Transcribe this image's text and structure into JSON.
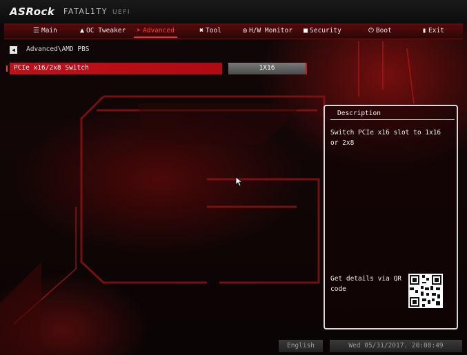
{
  "brand": {
    "logo": "ASRock",
    "series": "FATAL1TY",
    "uefi": "UEFI"
  },
  "nav": {
    "tabs": [
      {
        "label": "Main",
        "icon": "list-icon"
      },
      {
        "label": "OC Tweaker",
        "icon": "rocket-icon"
      },
      {
        "label": "Advanced",
        "icon": "arrow-icon",
        "active": true
      },
      {
        "label": "Tool",
        "icon": "tool-icon"
      },
      {
        "label": "H/W Monitor",
        "icon": "monitor-icon"
      },
      {
        "label": "Security",
        "icon": "shield-icon"
      },
      {
        "label": "Boot",
        "icon": "power-icon"
      },
      {
        "label": "Exit",
        "icon": "exit-icon"
      }
    ]
  },
  "breadcrumb": {
    "path": "Advanced\\AMD PBS"
  },
  "options": [
    {
      "label": "PCIe x16/2x8 Switch",
      "value": "1X16"
    }
  ],
  "description": {
    "title": "Description",
    "text": "Switch PCIe x16 slot to 1x16 or 2x8",
    "qr_text": "Get details via QR code"
  },
  "footer": {
    "language": "English",
    "datetime": "Wed 05/31/2017. 20:08:49"
  },
  "colors": {
    "accent": "#c0101a",
    "active_tab": "#ff3a3a"
  }
}
